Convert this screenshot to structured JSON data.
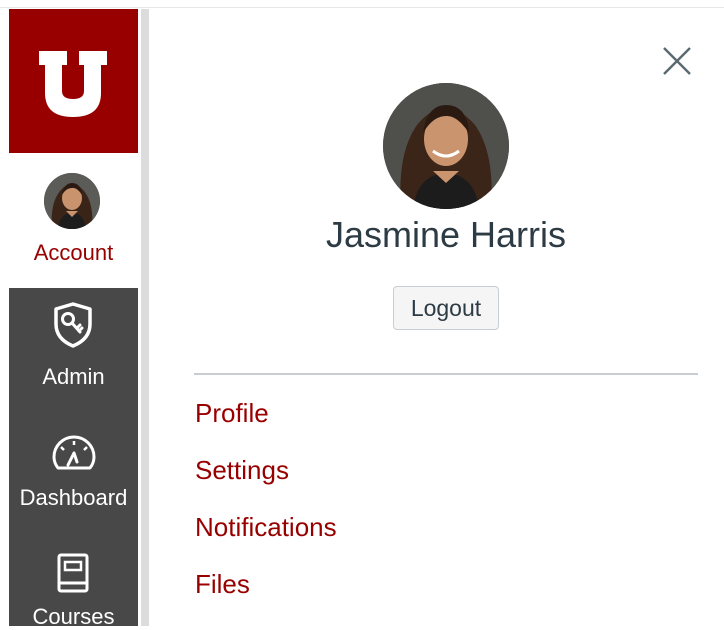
{
  "brand": {
    "logo_letter": "U",
    "primary_color": "#980000",
    "nav_bg": "#484848"
  },
  "nav": {
    "items": [
      {
        "label": "Account",
        "icon": "avatar"
      },
      {
        "label": "Admin",
        "icon": "shield-key-icon"
      },
      {
        "label": "Dashboard",
        "icon": "speedometer-icon"
      },
      {
        "label": "Courses",
        "icon": "book-icon"
      }
    ],
    "active": "Account"
  },
  "tray": {
    "close_icon": "close-icon",
    "user_name": "Jasmine Harris",
    "logout_label": "Logout",
    "links": [
      {
        "label": "Profile"
      },
      {
        "label": "Settings"
      },
      {
        "label": "Notifications"
      },
      {
        "label": "Files"
      }
    ]
  }
}
